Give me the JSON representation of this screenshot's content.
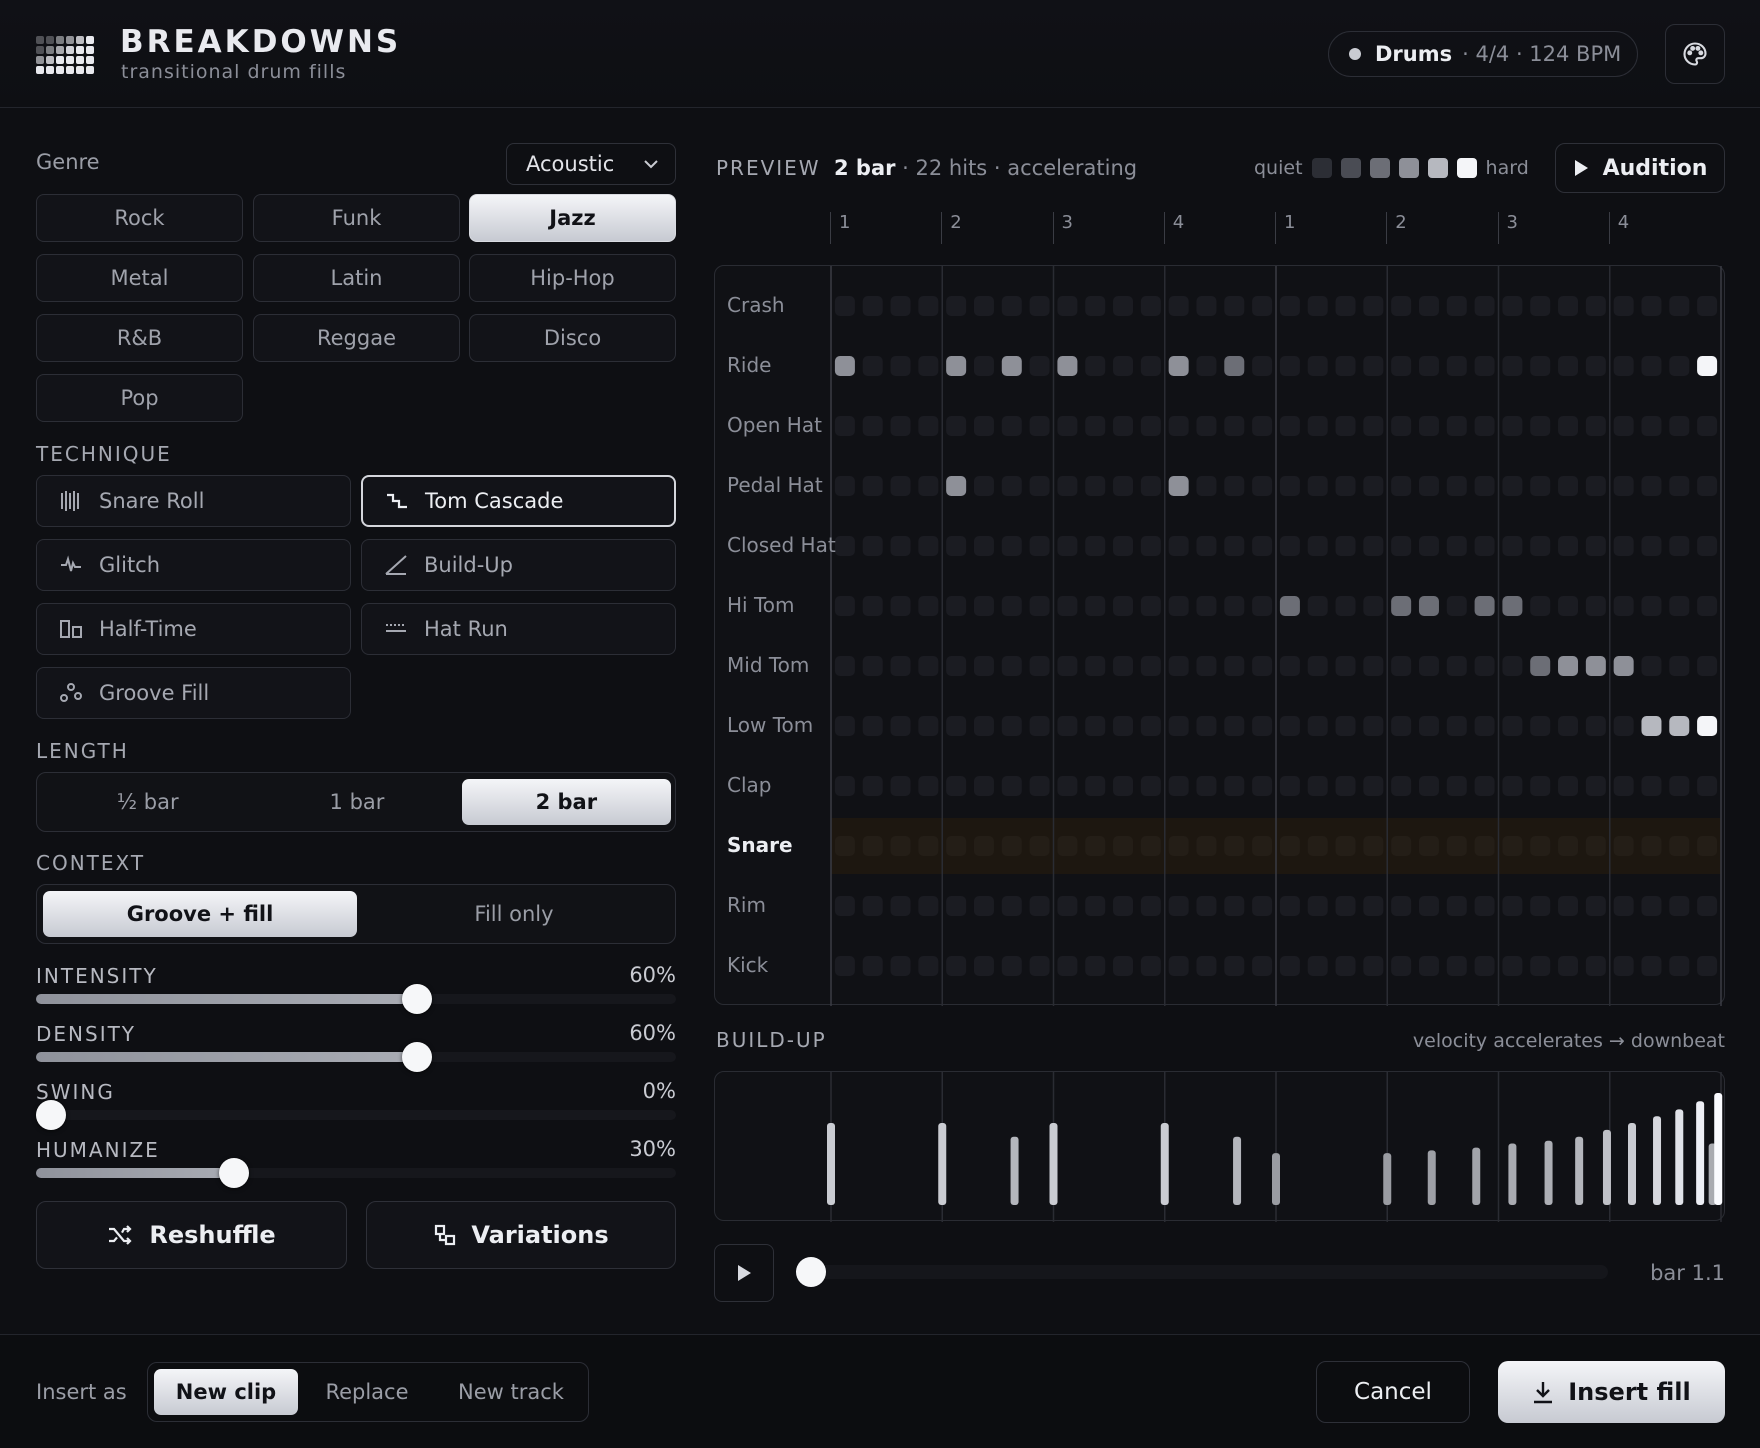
{
  "header": {
    "title": "BREAKDOWNS",
    "subtitle": "transitional drum fills",
    "track_name": "Drums",
    "track_meta": "· 4/4 · 124 BPM",
    "palette_icon": "palette-icon"
  },
  "genre": {
    "label": "Genre",
    "selected_kit": "Acoustic",
    "options": [
      "Rock",
      "Funk",
      "Jazz",
      "Metal",
      "Latin",
      "Hip-Hop",
      "R&B",
      "Reggae",
      "Disco",
      "Pop"
    ],
    "selected": "Jazz"
  },
  "technique": {
    "label": "TECHNIQUE",
    "options": [
      {
        "label": "Snare Roll",
        "icon": "snare-roll-icon"
      },
      {
        "label": "Tom Cascade",
        "icon": "tom-cascade-icon"
      },
      {
        "label": "Glitch",
        "icon": "glitch-icon"
      },
      {
        "label": "Build-Up",
        "icon": "build-up-icon"
      },
      {
        "label": "Half-Time",
        "icon": "half-time-icon"
      },
      {
        "label": "Hat Run",
        "icon": "hat-run-icon"
      },
      {
        "label": "Groove Fill",
        "icon": "groove-fill-icon"
      }
    ],
    "selected": "Tom Cascade"
  },
  "length": {
    "label": "LENGTH",
    "options": [
      "½ bar",
      "1 bar",
      "2 bar"
    ],
    "selected": "2 bar"
  },
  "context": {
    "label": "CONTEXT",
    "options": [
      "Groove + fill",
      "Fill only"
    ],
    "selected": "Groove + fill"
  },
  "sliders": [
    {
      "label": "INTENSITY",
      "display": "60%",
      "value": 0.6
    },
    {
      "label": "DENSITY",
      "display": "60%",
      "value": 0.6
    },
    {
      "label": "SWING",
      "display": "0%",
      "value": 0.0
    },
    {
      "label": "HUMANIZE",
      "display": "30%",
      "value": 0.3
    }
  ],
  "actions": {
    "reshuffle": "Reshuffle",
    "variations": "Variations"
  },
  "preview": {
    "label": "PREVIEW",
    "length": "2 bar",
    "meta": "· 22 hits · accelerating",
    "legend_quiet": "quiet",
    "legend_hard": "hard",
    "legend_colors": [
      "#2c2e35",
      "#4a4c54",
      "#6c6e76",
      "#8e9098",
      "#b6b8bf",
      "#f4f5f8"
    ],
    "audition": "Audition",
    "beats": [
      "1",
      "2",
      "3",
      "4",
      "1",
      "2",
      "3",
      "4"
    ],
    "lanes": [
      "Crash",
      "Ride",
      "Open Hat",
      "Pedal Hat",
      "Closed Hat",
      "Hi Tom",
      "Mid Tom",
      "Low Tom",
      "Clap",
      "Snare",
      "Rim",
      "Kick"
    ],
    "highlight_lane": "Snare",
    "steps": 32,
    "hits": [
      {
        "lane": 1,
        "step": 0,
        "vel": 3
      },
      {
        "lane": 1,
        "step": 4,
        "vel": 3
      },
      {
        "lane": 1,
        "step": 6,
        "vel": 3
      },
      {
        "lane": 1,
        "step": 8,
        "vel": 3
      },
      {
        "lane": 1,
        "step": 12,
        "vel": 3
      },
      {
        "lane": 1,
        "step": 14,
        "vel": 2
      },
      {
        "lane": 1,
        "step": 31,
        "vel": 5
      },
      {
        "lane": 3,
        "step": 4,
        "vel": 3
      },
      {
        "lane": 3,
        "step": 12,
        "vel": 3
      },
      {
        "lane": 5,
        "step": 16,
        "vel": 2
      },
      {
        "lane": 5,
        "step": 20,
        "vel": 2
      },
      {
        "lane": 5,
        "step": 21,
        "vel": 2
      },
      {
        "lane": 5,
        "step": 23,
        "vel": 2
      },
      {
        "lane": 5,
        "step": 24,
        "vel": 2
      },
      {
        "lane": 6,
        "step": 25,
        "vel": 2
      },
      {
        "lane": 6,
        "step": 26,
        "vel": 3
      },
      {
        "lane": 6,
        "step": 27,
        "vel": 3
      },
      {
        "lane": 6,
        "step": 28,
        "vel": 3
      },
      {
        "lane": 7,
        "step": 29,
        "vel": 4
      },
      {
        "lane": 7,
        "step": 30,
        "vel": 4
      },
      {
        "lane": 7,
        "step": 31,
        "vel": 5
      }
    ]
  },
  "buildup": {
    "label": "BUILD-UP",
    "note": "velocity accelerates → downbeat",
    "bars": [
      {
        "step": 0,
        "v": 0.6
      },
      {
        "step": 4,
        "v": 0.6
      },
      {
        "step": 6.6,
        "v": 0.5
      },
      {
        "step": 8,
        "v": 0.6
      },
      {
        "step": 12,
        "v": 0.6
      },
      {
        "step": 14.6,
        "v": 0.5
      },
      {
        "step": 16,
        "v": 0.38
      },
      {
        "step": 20,
        "v": 0.38
      },
      {
        "step": 21.6,
        "v": 0.4
      },
      {
        "step": 23.2,
        "v": 0.42
      },
      {
        "step": 24.5,
        "v": 0.45
      },
      {
        "step": 25.8,
        "v": 0.47
      },
      {
        "step": 26.9,
        "v": 0.5
      },
      {
        "step": 27.9,
        "v": 0.55
      },
      {
        "step": 28.8,
        "v": 0.6
      },
      {
        "step": 29.7,
        "v": 0.65
      },
      {
        "step": 30.5,
        "v": 0.7
      },
      {
        "step": 31.25,
        "v": 0.76
      },
      {
        "step": 31.7,
        "v": 0.45
      },
      {
        "step": 31.9,
        "v": 0.82
      }
    ]
  },
  "transport": {
    "position": "bar 1.1",
    "progress": 0.0
  },
  "footer": {
    "insert_as_label": "Insert as",
    "insert_options": [
      "New clip",
      "Replace",
      "New track"
    ],
    "insert_selected": "New clip",
    "cancel": "Cancel",
    "insert": "Insert fill"
  }
}
